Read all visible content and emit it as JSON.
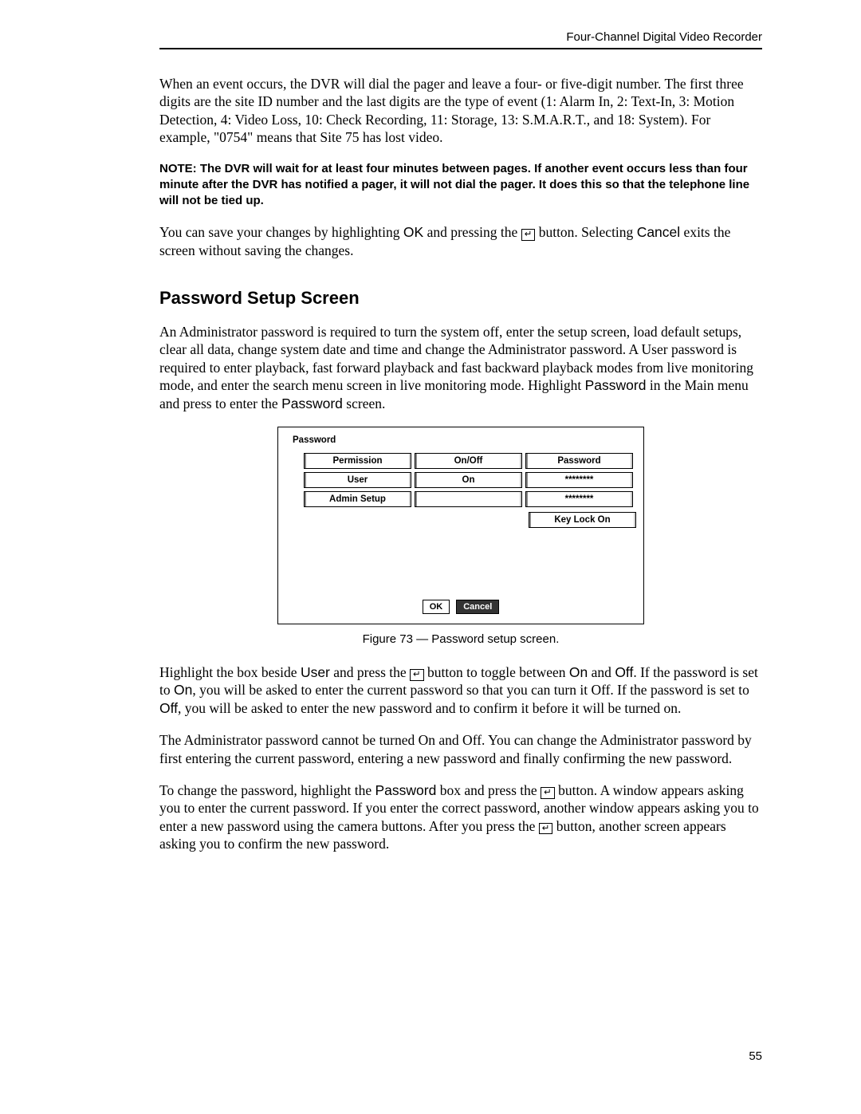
{
  "header": "Four-Channel Digital Video Recorder",
  "p1a": "When an event occurs, the DVR will dial the pager and leave a four- or five-digit number.  The first three digits are the site ID number and the last digits are the type of event (1: Alarm In, 2: Text-In, 3: Motion Detection, 4: Video Loss, 10: Check Recording, 11: Storage, 13: S.M.A.R.T., and 18: System).  For example, \"0754\" means that Site 75 has lost video.",
  "note": "NOTE:  The DVR will wait for at least four minutes between pages.  If another event occurs less than four minute after the DVR has notified a pager, it will not dial the pager.  It does this so that the telephone line will not be tied up.",
  "p2a": "You can save your changes by highlighting ",
  "p2_ok": "OK",
  "p2b": " and pressing the ",
  "p2c": " button.  Selecting ",
  "p2_cancel": "Cancel",
  "p2d": " exits the screen without saving the changes.",
  "h2": "Password Setup Screen",
  "p3a": "An Administrator password is required to turn the system off, enter the setup screen, load default setups, clear all data, change system date and time and change the Administrator password.  A User password is required to enter playback, fast forward playback and fast backward playback modes from live monitoring mode, and enter the search menu screen in live monitoring mode.  Highlight ",
  "p3_pw1": "Password",
  "p3b": " in the Main menu and press to enter the ",
  "p3_pw2": "Password",
  "p3c": " screen.",
  "fig": {
    "title": "Password",
    "hdr_perm": "Permission",
    "hdr_onoff": "On/Off",
    "hdr_pw": "Password",
    "row1_perm": "User",
    "row1_onoff": "On",
    "row1_pw": "********",
    "row2_perm": "Admin Setup",
    "row2_onoff": "",
    "row2_pw": "********",
    "keylock": "Key Lock On",
    "ok": "OK",
    "cancel": "Cancel"
  },
  "caption": "Figure 73 — Password setup screen.",
  "p4a": "Highlight the box beside ",
  "p4_user": "User",
  "p4b": " and press the ",
  "p4c": " button to toggle between ",
  "p4_on": "On",
  "p4d": " and ",
  "p4_off": "Off",
  "p4e": ".  If the password is set to ",
  "p4_on2": "On",
  "p4f": ", you will be asked to enter the current password so that you can turn it Off.  If the password is set to ",
  "p4_off2": "Off",
  "p4g": ", you will be asked to enter the new password and to confirm it before it will be turned on.",
  "p5": "The Administrator password cannot be turned On and Off.  You can change the Administrator password by first entering the current password, entering a new password and finally confirming the new password.",
  "p6a": "To change the password, highlight the ",
  "p6_pw": "Password",
  "p6b": " box and press the ",
  "p6c": " button.  A window appears asking you to enter the current password.  If you enter the correct password, another window appears asking you to enter a new password using the camera buttons.  After you press the ",
  "p6d": " button, another screen appears asking you to confirm the new password.",
  "enter_glyph": "↵",
  "pagenum": "55"
}
